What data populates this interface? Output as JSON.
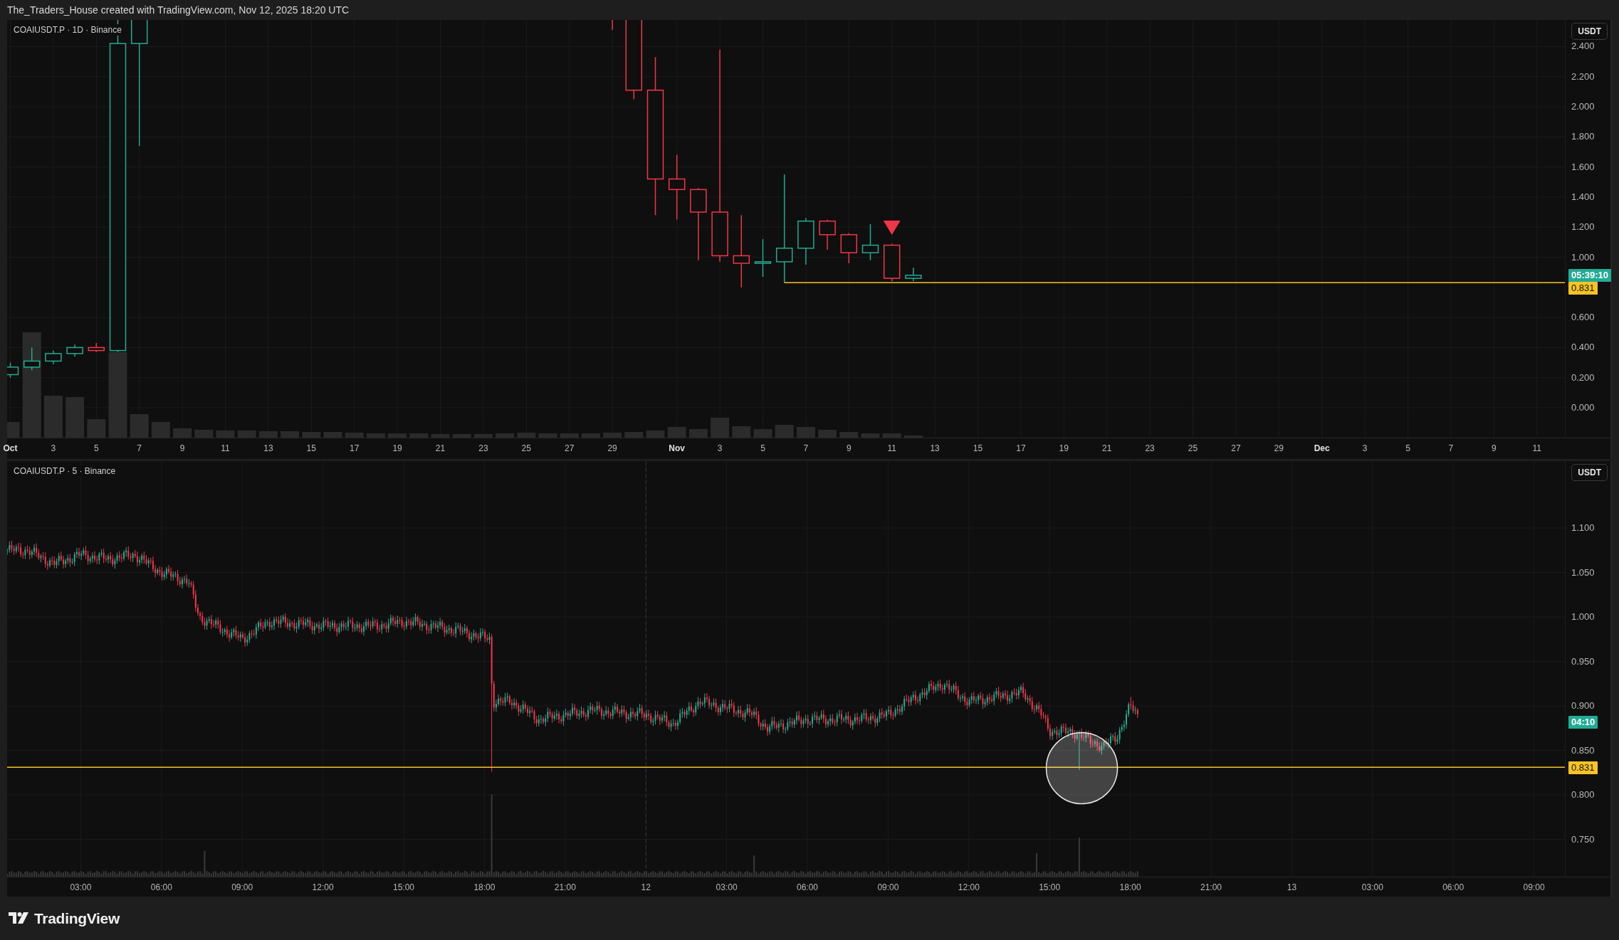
{
  "header": {
    "title": "The_Traders_House created with TradingView.com, Nov 12, 2025 18:20 UTC"
  },
  "panes": [
    {
      "legend": "COAIUSDT.P · 1D · Binance",
      "currency_button": "USDT",
      "price_ticks": [
        "2.400",
        "2.200",
        "2.000",
        "1.800",
        "1.600",
        "1.400",
        "1.200",
        "1.000",
        "0.600",
        "0.400",
        "0.200",
        "0.000"
      ],
      "badges": [
        {
          "kind": "countdown",
          "text": "05:39:10"
        },
        {
          "kind": "price",
          "text": "0.831"
        }
      ],
      "time_ticks": [
        {
          "label": "Oct",
          "kind": "month"
        },
        {
          "label": "3",
          "kind": "day"
        },
        {
          "label": "5",
          "kind": "day"
        },
        {
          "label": "7",
          "kind": "day"
        },
        {
          "label": "9",
          "kind": "day"
        },
        {
          "label": "11",
          "kind": "day"
        },
        {
          "label": "13",
          "kind": "day"
        },
        {
          "label": "15",
          "kind": "day"
        },
        {
          "label": "17",
          "kind": "day"
        },
        {
          "label": "19",
          "kind": "day"
        },
        {
          "label": "21",
          "kind": "day"
        },
        {
          "label": "23",
          "kind": "day"
        },
        {
          "label": "25",
          "kind": "day"
        },
        {
          "label": "27",
          "kind": "day"
        },
        {
          "label": "29",
          "kind": "day"
        },
        {
          "label": "Nov",
          "kind": "month"
        },
        {
          "label": "3",
          "kind": "day"
        },
        {
          "label": "5",
          "kind": "day"
        },
        {
          "label": "7",
          "kind": "day"
        },
        {
          "label": "9",
          "kind": "day"
        },
        {
          "label": "11",
          "kind": "day"
        },
        {
          "label": "13",
          "kind": "day"
        },
        {
          "label": "15",
          "kind": "day"
        },
        {
          "label": "17",
          "kind": "day"
        },
        {
          "label": "19",
          "kind": "day"
        },
        {
          "label": "21",
          "kind": "day"
        },
        {
          "label": "23",
          "kind": "day"
        },
        {
          "label": "25",
          "kind": "day"
        },
        {
          "label": "27",
          "kind": "day"
        },
        {
          "label": "29",
          "kind": "day"
        },
        {
          "label": "Dec",
          "kind": "month"
        },
        {
          "label": "3",
          "kind": "day"
        },
        {
          "label": "5",
          "kind": "day"
        },
        {
          "label": "7",
          "kind": "day"
        },
        {
          "label": "9",
          "kind": "day"
        },
        {
          "label": "11",
          "kind": "day"
        }
      ]
    },
    {
      "legend": "COAIUSDT.P · 5 · Binance",
      "currency_button": "USDT",
      "price_ticks": [
        "1.100",
        "1.050",
        "1.000",
        "0.950",
        "0.900",
        "0.850",
        "0.800",
        "0.750"
      ],
      "badges": [
        {
          "kind": "countdown",
          "text": "04:10"
        },
        {
          "kind": "price",
          "text": "0.831"
        }
      ],
      "time_ticks": [
        {
          "label": "03:00",
          "kind": "time"
        },
        {
          "label": "06:00",
          "kind": "time"
        },
        {
          "label": "09:00",
          "kind": "time"
        },
        {
          "label": "12:00",
          "kind": "time"
        },
        {
          "label": "15:00",
          "kind": "time"
        },
        {
          "label": "18:00",
          "kind": "time"
        },
        {
          "label": "21:00",
          "kind": "time"
        },
        {
          "label": "12",
          "kind": "day"
        },
        {
          "label": "03:00",
          "kind": "time"
        },
        {
          "label": "06:00",
          "kind": "time"
        },
        {
          "label": "09:00",
          "kind": "time"
        },
        {
          "label": "12:00",
          "kind": "time"
        },
        {
          "label": "15:00",
          "kind": "time"
        },
        {
          "label": "18:00",
          "kind": "time"
        },
        {
          "label": "21:00",
          "kind": "time"
        },
        {
          "label": "13",
          "kind": "day"
        },
        {
          "label": "03:00",
          "kind": "time"
        },
        {
          "label": "06:00",
          "kind": "time"
        },
        {
          "label": "09:00",
          "kind": "time"
        }
      ]
    }
  ],
  "footer": {
    "brand": "TradingView"
  }
}
